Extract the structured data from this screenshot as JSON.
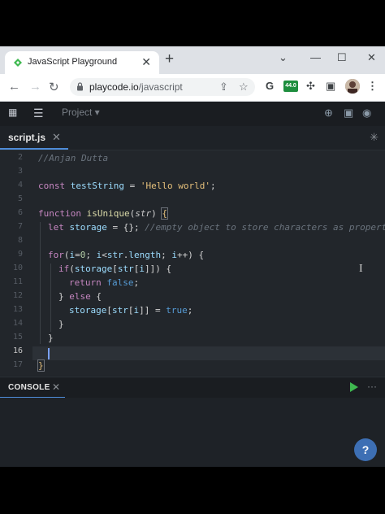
{
  "browser": {
    "tab_title": "JavaScript Playground",
    "tab_close": "✕",
    "new_tab": "+",
    "window_minimize": "⌄",
    "window_restore": "—",
    "window_maximize": "☐",
    "window_close": "✕",
    "url_host": "playcode.io",
    "url_path": "/javascript",
    "extension_badge": "44.0"
  },
  "ide": {
    "project_label": "Project ▾",
    "file_tab": "script.js",
    "file_tab_close": "✕"
  },
  "editor": {
    "line_numbers": [
      "2",
      "3",
      "4",
      "5",
      "6",
      "7",
      "8",
      "9",
      "10",
      "11",
      "12",
      "13",
      "14",
      "15",
      "16",
      "17"
    ]
  },
  "console": {
    "label": "CONSOLE",
    "close": "✕",
    "more": "···"
  },
  "help": {
    "label": "?"
  },
  "colors": {
    "accent": "#4e8cd8",
    "run": "#3fb950",
    "editor_bg": "#22262b",
    "keyword": "#c586c0",
    "function": "#dcdcaa",
    "string": "#e6c07b"
  }
}
